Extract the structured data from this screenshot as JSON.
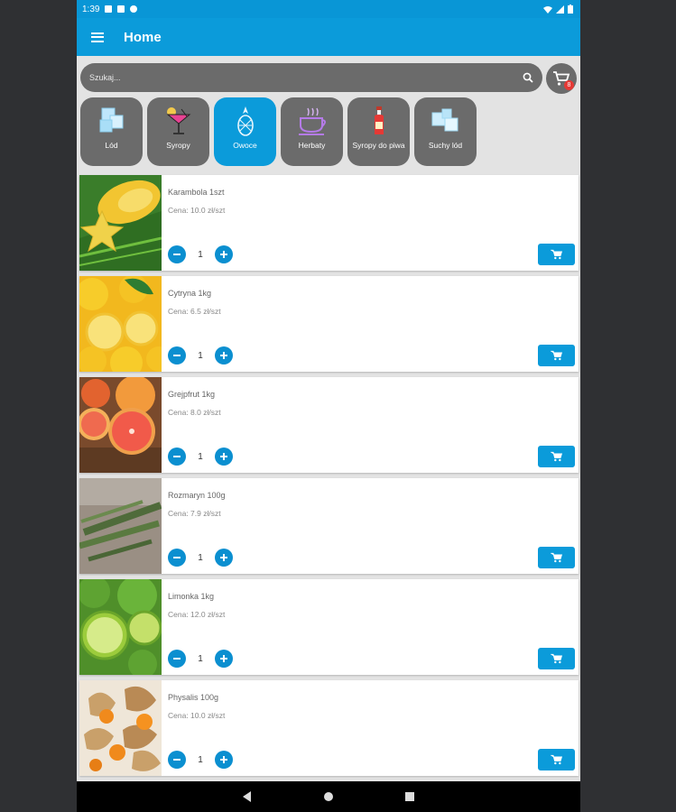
{
  "status_bar": {
    "time": "1:39"
  },
  "app_bar": {
    "title": "Home"
  },
  "search": {
    "placeholder": "Szukaj..."
  },
  "cart": {
    "badge_count": "8"
  },
  "categories": [
    {
      "label": "Lód",
      "icon": "ice-cubes-icon",
      "active": false
    },
    {
      "label": "Syropy",
      "icon": "cocktail-glass-icon",
      "active": false
    },
    {
      "label": "Owoce",
      "icon": "pineapple-icon",
      "active": true
    },
    {
      "label": "Herbaty",
      "icon": "tea-cup-icon",
      "active": false
    },
    {
      "label": "Syropy do piwa",
      "icon": "syrup-bottle-icon",
      "active": false
    },
    {
      "label": "Suchy lód",
      "icon": "dry-ice-icon",
      "active": false
    }
  ],
  "products": [
    {
      "name": "Karambola 1szt",
      "price": "Cena: 10.0 zł/szt",
      "qty": "1",
      "image": "carambola-photo"
    },
    {
      "name": "Cytryna 1kg",
      "price": "Cena: 6.5 zł/szt",
      "qty": "1",
      "image": "lemon-photo"
    },
    {
      "name": "Grejpfrut 1kg",
      "price": "Cena: 8.0 zł/szt",
      "qty": "1",
      "image": "grapefruit-photo"
    },
    {
      "name": "Rozmaryn 100g",
      "price": "Cena: 7.9 zł/szt",
      "qty": "1",
      "image": "rosemary-photo"
    },
    {
      "name": "Limonka 1kg",
      "price": "Cena: 12.0 zł/szt",
      "qty": "1",
      "image": "lime-photo"
    },
    {
      "name": "Physalis 100g",
      "price": "Cena: 10.0 zł/szt",
      "qty": "1",
      "image": "physalis-photo"
    }
  ],
  "colors": {
    "primary": "#0b9bda",
    "chip": "#6b6b6b",
    "badge": "#e53935"
  }
}
